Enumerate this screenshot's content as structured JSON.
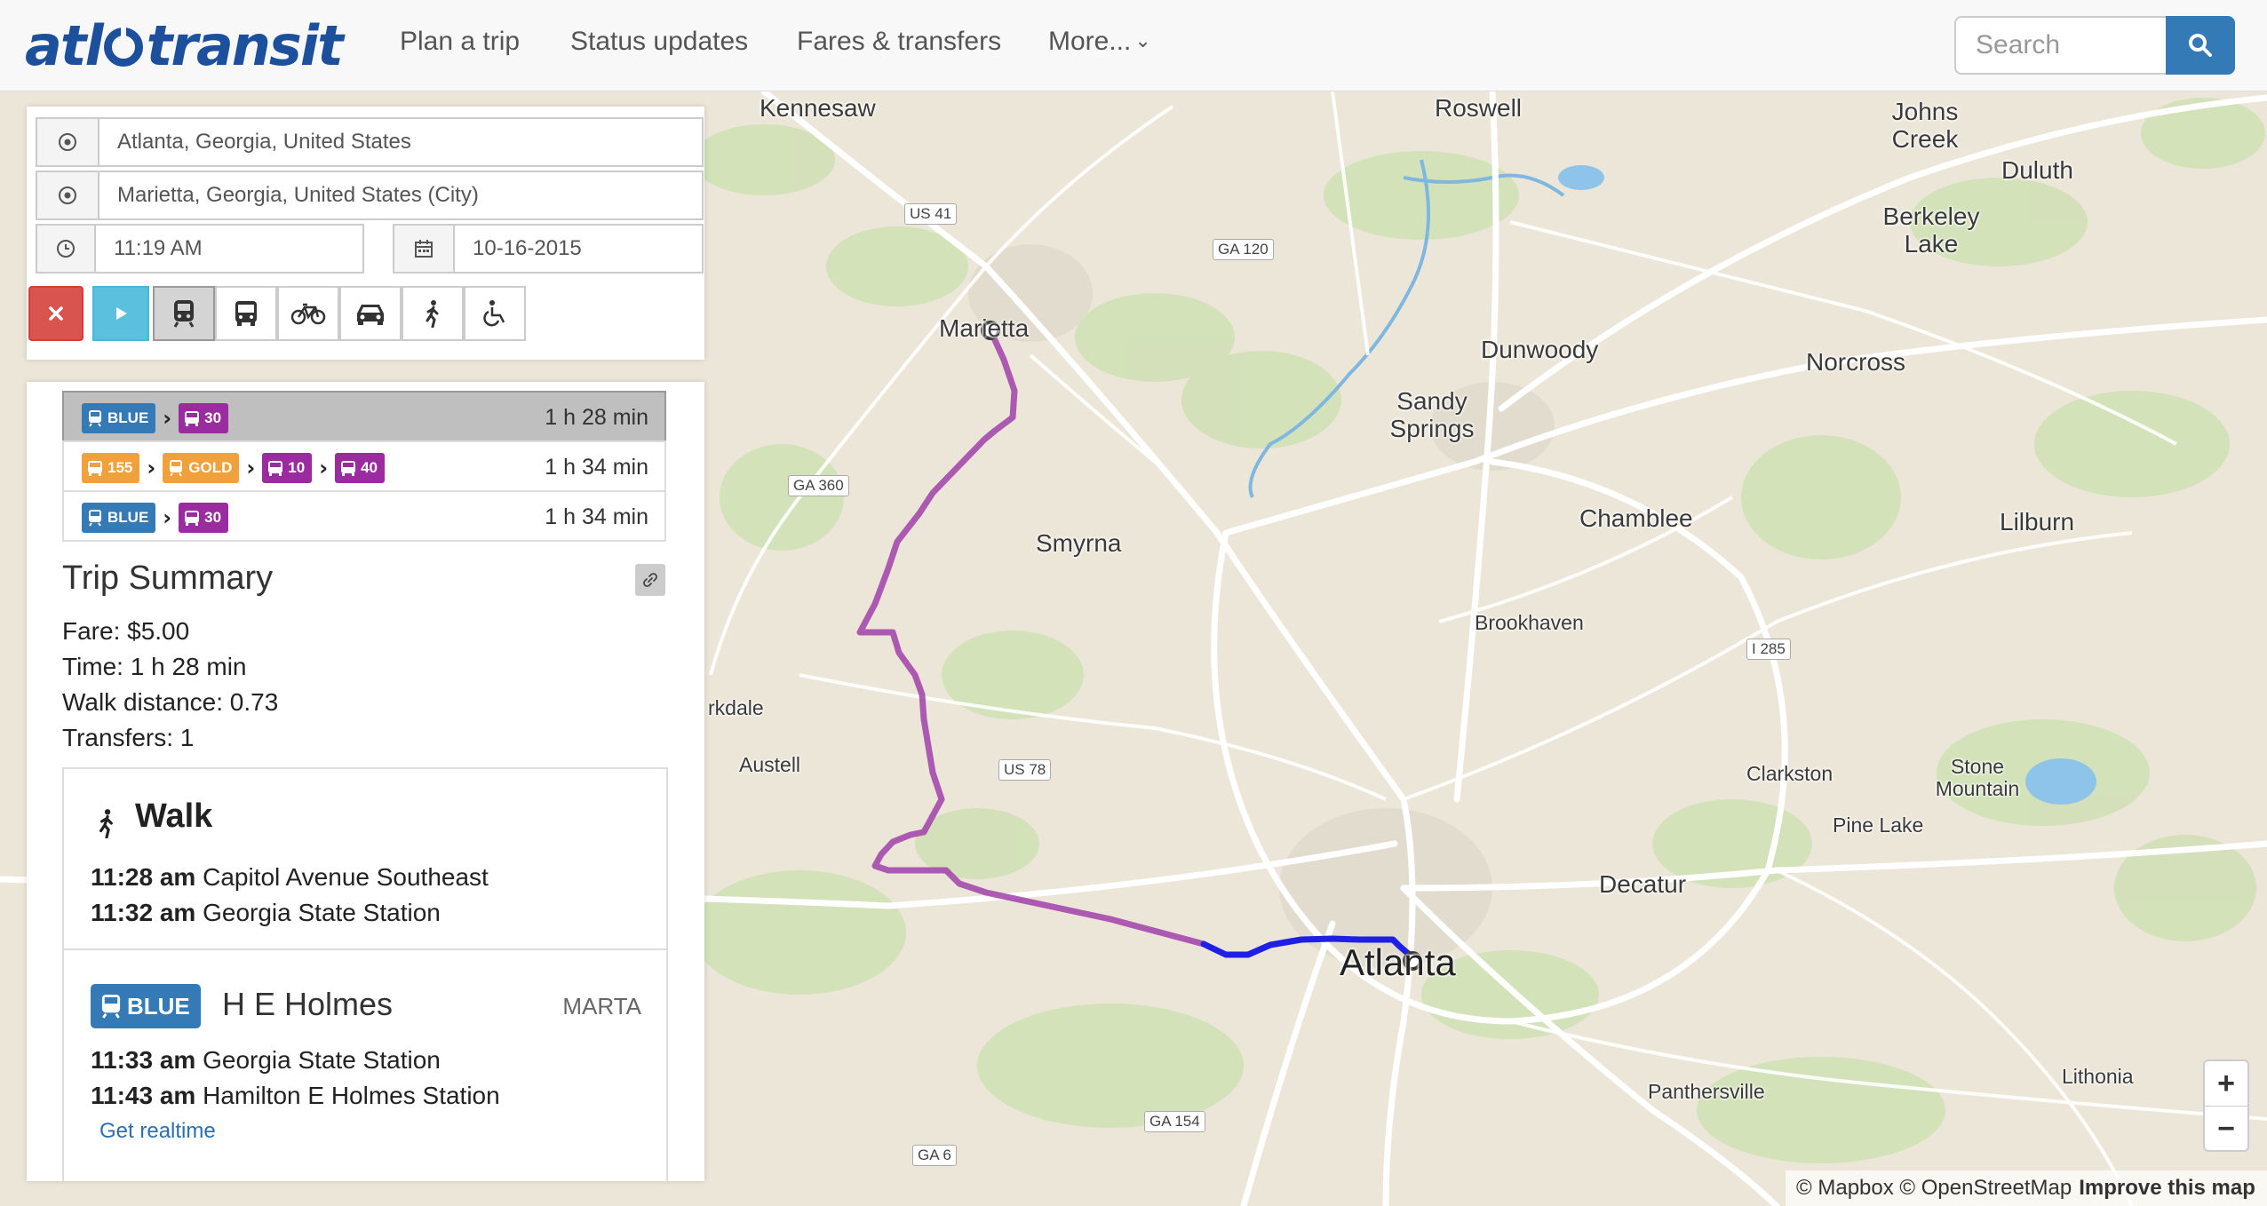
{
  "navbar": {
    "logo_left": "atl",
    "logo_right": "transit",
    "links": [
      "Plan a trip",
      "Status updates",
      "Fares & transfers",
      "More..."
    ],
    "search_placeholder": "Search"
  },
  "planner": {
    "from": "Atlanta, Georgia, United States",
    "to": "Marietta, Georgia, United States (City)",
    "time": "11:19  AM",
    "date": "10-16-2015",
    "modes": [
      "cancel-icon",
      "play-icon",
      "train-icon",
      "bus-icon",
      "bicycle-icon",
      "car-icon",
      "walk-icon",
      "wheelchair-icon"
    ]
  },
  "itineraries": [
    {
      "legs": [
        {
          "label": "BLUE",
          "type": "train",
          "color": "blue"
        },
        {
          "label": "30",
          "type": "bus",
          "color": "purple"
        }
      ],
      "duration": "1 h 28 min",
      "selected": true
    },
    {
      "legs": [
        {
          "label": "155",
          "type": "bus",
          "color": "orange"
        },
        {
          "label": "GOLD",
          "type": "train",
          "color": "orange"
        },
        {
          "label": "10",
          "type": "bus",
          "color": "purple"
        },
        {
          "label": "40",
          "type": "bus",
          "color": "purple"
        }
      ],
      "duration": "1 h 34 min",
      "selected": false
    },
    {
      "legs": [
        {
          "label": "BLUE",
          "type": "train",
          "color": "blue"
        },
        {
          "label": "30",
          "type": "bus",
          "color": "purple"
        }
      ],
      "duration": "1 h 34 min",
      "selected": false
    }
  ],
  "summary": {
    "title": "Trip Summary",
    "fare": "Fare: $5.00",
    "time": "Time: 1 h 28 min",
    "walk": "Walk distance: 0.73",
    "transfers": "Transfers: 1"
  },
  "walk_leg": {
    "title": "Walk",
    "start_time": "11:28 am",
    "start_place": "Capitol Avenue Southeast",
    "end_time": "11:32 am",
    "end_place": "Georgia State Station"
  },
  "transit_leg": {
    "badge": "BLUE",
    "route": "H E Holmes",
    "agency": "MARTA",
    "start_time": "11:33 am",
    "start_place": "Georgia State Station",
    "end_time": "11:43 am",
    "end_place": "Hamilton E Holmes Station",
    "realtime": "Get realtime"
  },
  "map": {
    "labels": [
      "Kennesaw",
      "Roswell",
      "Johns Creek",
      "Duluth",
      "Berkeley Lake",
      "Marietta",
      "Dunwoody",
      "Norcross",
      "Sandy Springs",
      "Smyrna",
      "Chamblee",
      "Lilburn",
      "Brookhaven",
      "rkdale",
      "Austell",
      "Clarkston",
      "Stone Mountain",
      "Pine Lake",
      "Decatur",
      "Atlanta",
      "Panthersville",
      "Lithonia"
    ],
    "roads": [
      "US 41",
      "GA 120",
      "GA 360",
      "I 285",
      "US 78",
      "GA 154",
      "GA 6"
    ],
    "route_colors": {
      "bus": "#a54aad",
      "train": "#1f1fe6"
    },
    "zoom_in": "+",
    "zoom_out": "−",
    "attribution_a": "© Mapbox © OpenStreetMap",
    "attribution_b": "Improve this map"
  }
}
